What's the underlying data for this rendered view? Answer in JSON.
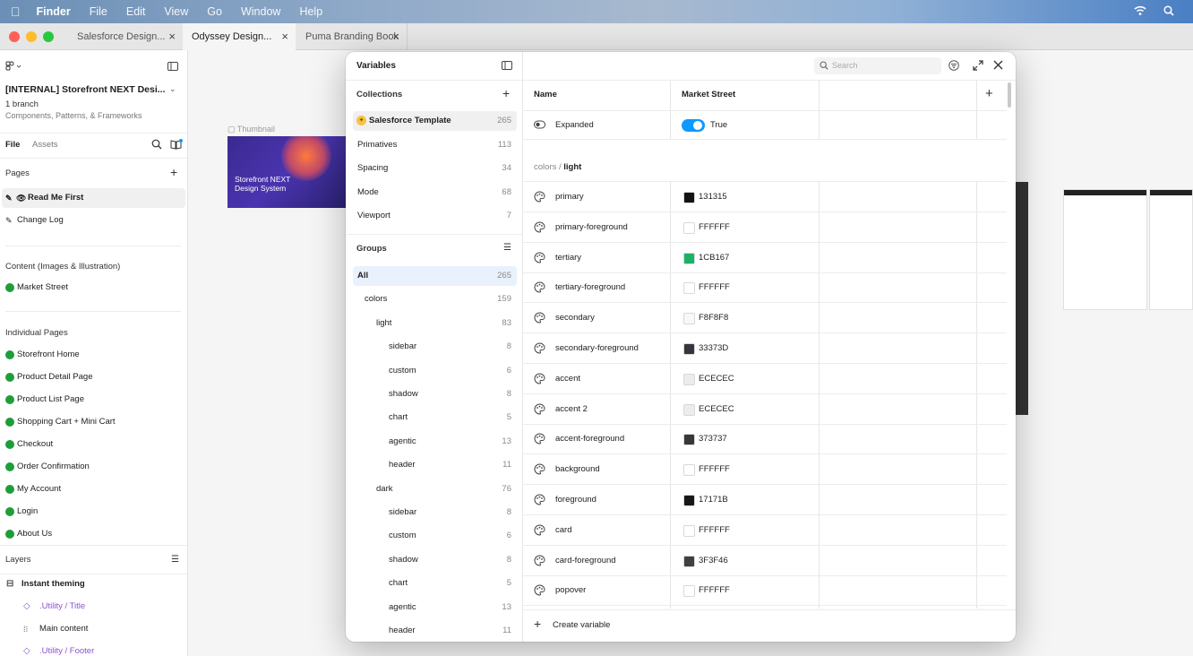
{
  "menubar": {
    "items": [
      "Finder",
      "File",
      "Edit",
      "View",
      "Go",
      "Window",
      "Help"
    ]
  },
  "tabs": [
    {
      "label": "Salesforce Design..."
    },
    {
      "label": "Odyssey Design..."
    },
    {
      "label": "Puma Branding Book"
    }
  ],
  "sidebar": {
    "file_title": "[INTERNAL] Storefront NEXT Desi...",
    "branch": "1 branch",
    "subtitle": "Components, Patterns, & Frameworks",
    "tab_file": "File",
    "tab_assets": "Assets",
    "pages_heading": "Pages",
    "pages": [
      {
        "label": "Read Me First"
      },
      {
        "label": "Change Log"
      }
    ],
    "section_content": "Content (Images & Illustration)",
    "content_pages": [
      {
        "label": "Market Street"
      }
    ],
    "section_individual": "Individual Pages",
    "individual_pages": [
      {
        "label": "Storefront Home"
      },
      {
        "label": "Product Detail Page"
      },
      {
        "label": "Product List Page"
      },
      {
        "label": "Shopping Cart + Mini Cart"
      },
      {
        "label": "Checkout"
      },
      {
        "label": "Order Confirmation"
      },
      {
        "label": "My Account"
      },
      {
        "label": "Login"
      },
      {
        "label": "About Us"
      }
    ],
    "layers_heading": "Layers",
    "layers": [
      {
        "label": "Instant theming"
      },
      {
        "label": ".Utility / Title"
      },
      {
        "label": "Main content"
      },
      {
        "label": ".Utility / Footer"
      }
    ]
  },
  "canvas": {
    "thumbnail_label": "Thumbnail",
    "thumb_title_line1": "Storefront NEXT",
    "thumb_title_line2": "Design System"
  },
  "modal": {
    "title": "Variables",
    "search_placeholder": "Search",
    "collections_heading": "Collections",
    "collections": [
      {
        "label": "Salesforce Template",
        "count": "265"
      },
      {
        "label": "Primatives",
        "count": "113"
      },
      {
        "label": "Spacing",
        "count": "34"
      },
      {
        "label": "Mode",
        "count": "68"
      },
      {
        "label": "Viewport",
        "count": "7"
      }
    ],
    "groups_heading": "Groups",
    "groups": [
      {
        "label": "All",
        "count": "265"
      },
      {
        "label": "colors",
        "count": "159"
      },
      {
        "label": "light",
        "count": "83"
      },
      {
        "label": "sidebar",
        "count": "8"
      },
      {
        "label": "custom",
        "count": "6"
      },
      {
        "label": "shadow",
        "count": "8"
      },
      {
        "label": "chart",
        "count": "5"
      },
      {
        "label": "agentic",
        "count": "13"
      },
      {
        "label": "header",
        "count": "11"
      },
      {
        "label": "dark",
        "count": "76"
      },
      {
        "label": "sidebar",
        "count": "8"
      },
      {
        "label": "custom",
        "count": "6"
      },
      {
        "label": "shadow",
        "count": "8"
      },
      {
        "label": "chart",
        "count": "5"
      },
      {
        "label": "agentic",
        "count": "13"
      },
      {
        "label": "header",
        "count": "11"
      }
    ],
    "col_name": "Name",
    "col_mode": "Market Street",
    "expanded": {
      "label": "Expanded",
      "value": "True"
    },
    "group_path_prefix": "colors /",
    "group_path_current": "light",
    "variables": [
      {
        "name": "primary",
        "hex": "131315",
        "color": "#131315"
      },
      {
        "name": "primary-foreground",
        "hex": "FFFFFF",
        "color": "#FFFFFF"
      },
      {
        "name": "tertiary",
        "hex": "1CB167",
        "color": "#1CB167"
      },
      {
        "name": "tertiary-foreground",
        "hex": "FFFFFF",
        "color": "#FFFFFF"
      },
      {
        "name": "secondary",
        "hex": "F8F8F8",
        "color": "#F8F8F8"
      },
      {
        "name": "secondary-foreground",
        "hex": "33373D",
        "color": "#33373D"
      },
      {
        "name": "accent",
        "hex": "ECECEC",
        "color": "#ECECEC"
      },
      {
        "name": "accent 2",
        "hex": "ECECEC",
        "color": "#ECECEC"
      },
      {
        "name": "accent-foreground",
        "hex": "373737",
        "color": "#373737"
      },
      {
        "name": "background",
        "hex": "FFFFFF",
        "color": "#FFFFFF"
      },
      {
        "name": "foreground",
        "hex": "17171B",
        "color": "#17171B"
      },
      {
        "name": "card",
        "hex": "FFFFFF",
        "color": "#FFFFFF"
      },
      {
        "name": "card-foreground",
        "hex": "3F3F46",
        "color": "#3F3F46"
      },
      {
        "name": "popover",
        "hex": "FFFFFF",
        "color": "#FFFFFF"
      }
    ],
    "create_label": "Create variable"
  },
  "colors": {
    "accent": "#0d99ff",
    "toggle_on": "#0d99ff",
    "green_icon": "#1f9d3a"
  }
}
